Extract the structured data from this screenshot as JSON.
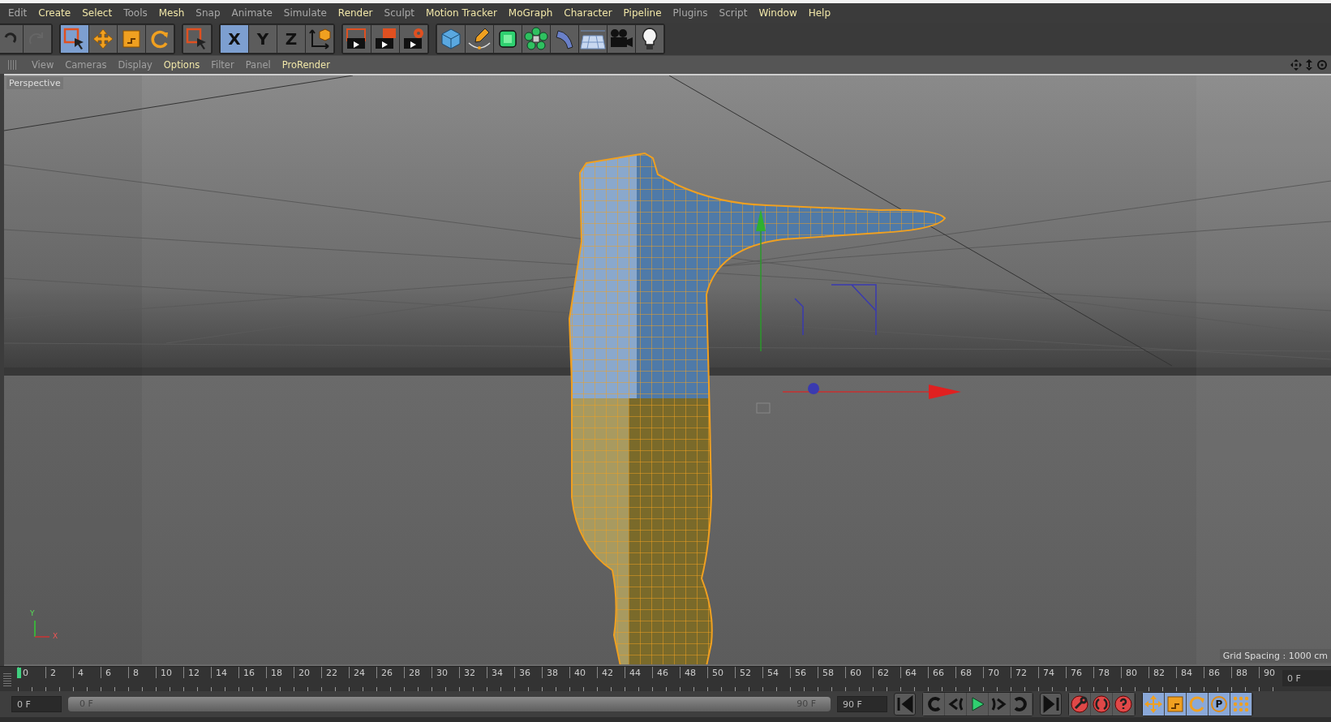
{
  "menu": [
    {
      "label": "Edit",
      "highlighted": false
    },
    {
      "label": "Create",
      "highlighted": true
    },
    {
      "label": "Select",
      "highlighted": true
    },
    {
      "label": "Tools",
      "highlighted": false
    },
    {
      "label": "Mesh",
      "highlighted": true
    },
    {
      "label": "Snap",
      "highlighted": false
    },
    {
      "label": "Animate",
      "highlighted": false
    },
    {
      "label": "Simulate",
      "highlighted": false
    },
    {
      "label": "Render",
      "highlighted": true
    },
    {
      "label": "Sculpt",
      "highlighted": false
    },
    {
      "label": "Motion Tracker",
      "highlighted": true
    },
    {
      "label": "MoGraph",
      "highlighted": true
    },
    {
      "label": "Character",
      "highlighted": true
    },
    {
      "label": "Pipeline",
      "highlighted": true
    },
    {
      "label": "Plugins",
      "highlighted": false
    },
    {
      "label": "Script",
      "highlighted": false
    },
    {
      "label": "Window",
      "highlighted": true
    },
    {
      "label": "Help",
      "highlighted": true
    }
  ],
  "toolbar": [
    {
      "tools": [
        {
          "kind": "undo",
          "selected": false
        },
        {
          "kind": "redo",
          "selected": false
        }
      ]
    },
    {
      "tools": [
        {
          "kind": "live-select",
          "selected": true
        },
        {
          "kind": "move",
          "selected": false
        },
        {
          "kind": "scale",
          "selected": false
        },
        {
          "kind": "rotate",
          "selected": false
        }
      ]
    },
    {
      "tools": [
        {
          "kind": "rect-select",
          "selected": false
        }
      ]
    },
    {
      "tools": [
        {
          "kind": "axis",
          "label": "X",
          "selected": true
        },
        {
          "kind": "axis",
          "label": "Y",
          "selected": false
        },
        {
          "kind": "axis",
          "label": "Z",
          "selected": false
        },
        {
          "kind": "coords",
          "selected": false
        }
      ]
    },
    {
      "tools": [
        {
          "kind": "render-view",
          "selected": false
        },
        {
          "kind": "render-picture",
          "selected": false
        },
        {
          "kind": "render-settings",
          "selected": false
        }
      ]
    },
    {
      "tools": [
        {
          "kind": "cube",
          "selected": false
        },
        {
          "kind": "pen",
          "selected": false
        },
        {
          "kind": "subdivide",
          "selected": false
        },
        {
          "kind": "cloner",
          "selected": false
        },
        {
          "kind": "bend",
          "selected": false
        },
        {
          "kind": "floor",
          "selected": false
        },
        {
          "kind": "camera",
          "selected": false
        },
        {
          "kind": "light",
          "selected": false
        }
      ]
    }
  ],
  "viewport": {
    "menu": [
      {
        "label": "View",
        "highlighted": false
      },
      {
        "label": "Cameras",
        "highlighted": false
      },
      {
        "label": "Display",
        "highlighted": false
      },
      {
        "label": "Options",
        "highlighted": true
      },
      {
        "label": "Filter",
        "highlighted": false
      },
      {
        "label": "Panel",
        "highlighted": false
      },
      {
        "label": "ProRender",
        "highlighted": true
      }
    ],
    "camera": "Perspective",
    "grid_spacing": "Grid Spacing : 1000 cm",
    "axis_labels": [
      "Y",
      "X"
    ]
  },
  "timeline": {
    "ticks": [
      "0",
      "2",
      "4",
      "6",
      "8",
      "10",
      "12",
      "14",
      "16",
      "18",
      "20",
      "22",
      "24",
      "26",
      "28",
      "30",
      "32",
      "34",
      "36",
      "38",
      "40",
      "42",
      "44",
      "46",
      "48",
      "50",
      "52",
      "54",
      "56",
      "58",
      "60",
      "62",
      "64",
      "66",
      "68",
      "70",
      "72",
      "74",
      "76",
      "78",
      "80",
      "82",
      "84",
      "86",
      "88",
      "90"
    ],
    "playhead": {
      "level": 0
    },
    "current_field": "0 F"
  },
  "transport": {
    "start_field": "0 F",
    "range": {
      "start": "0 F",
      "end": "90 F",
      "level": 1
    },
    "end_field": "90 F",
    "buttons": [
      {
        "kind": "first"
      },
      {
        "kind": "prev-key"
      },
      {
        "kind": "prev-frame"
      },
      {
        "kind": "play"
      },
      {
        "kind": "next-frame"
      },
      {
        "kind": "next-key"
      },
      {
        "kind": "last"
      }
    ],
    "record": [
      {
        "kind": "record-key"
      },
      {
        "kind": "autokey"
      },
      {
        "kind": "keyset"
      }
    ],
    "modes": [
      {
        "kind": "move",
        "on": true
      },
      {
        "kind": "scale",
        "on": true
      },
      {
        "kind": "rotate",
        "on": true
      },
      {
        "kind": "param",
        "label": "P",
        "on": true
      },
      {
        "kind": "points",
        "on": true
      }
    ]
  }
}
